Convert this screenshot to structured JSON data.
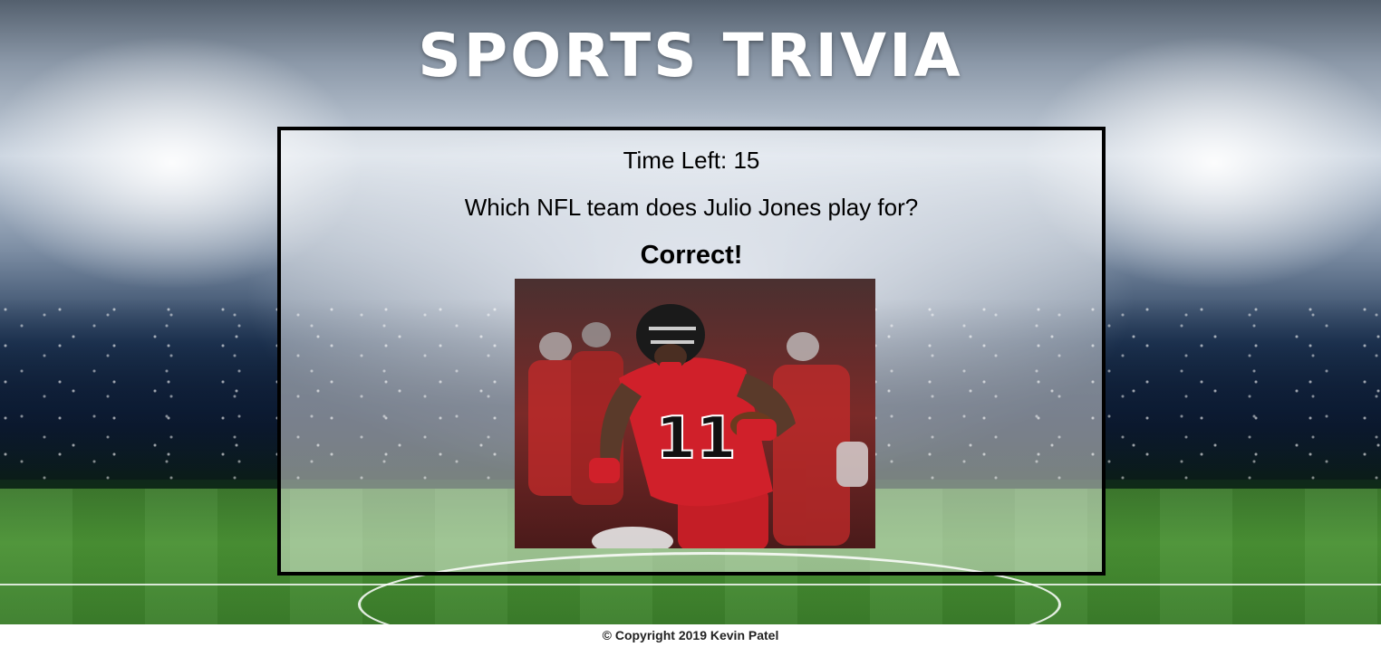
{
  "header": {
    "title": "SPORTS TRIVIA"
  },
  "game": {
    "time_left": "Time Left: 15",
    "question": "Which NFL team does Julio Jones play for?",
    "result": "Correct!",
    "image_jersey_number": "11"
  },
  "footer": {
    "copyright": "© Copyright 2019 Kevin Patel"
  },
  "colors": {
    "panel_border": "#000000",
    "title_text": "#ffffff",
    "jersey_red": "#d0202a"
  }
}
